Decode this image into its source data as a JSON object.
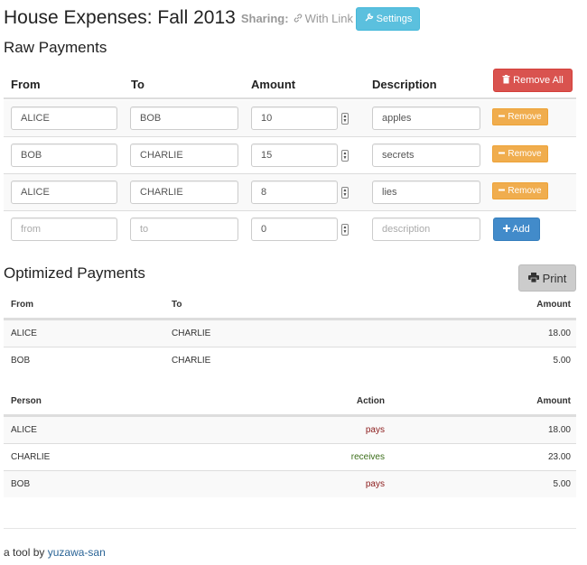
{
  "header": {
    "title": "House Expenses: Fall 2013",
    "sharing_label": "Sharing:",
    "sharing_value": "With Link",
    "settings_label": "Settings"
  },
  "raw_payments": {
    "title": "Raw Payments",
    "columns": [
      "From",
      "To",
      "Amount",
      "Description"
    ],
    "remove_all_label": "Remove All",
    "remove_label": "Remove",
    "add_label": "Add",
    "rows": [
      {
        "from": "ALICE",
        "to": "BOB",
        "amount": "10",
        "description": "apples"
      },
      {
        "from": "BOB",
        "to": "CHARLIE",
        "amount": "15",
        "description": "secrets"
      },
      {
        "from": "ALICE",
        "to": "CHARLIE",
        "amount": "8",
        "description": "lies"
      }
    ],
    "new_row": {
      "from_placeholder": "from",
      "to_placeholder": "to",
      "amount_value": "0",
      "description_placeholder": "description"
    }
  },
  "optimized": {
    "title": "Optimized Payments",
    "print_label": "Print",
    "columns": [
      "From",
      "To",
      "Amount"
    ],
    "rows": [
      {
        "from": "ALICE",
        "to": "CHARLIE",
        "amount": "18.00"
      },
      {
        "from": "BOB",
        "to": "CHARLIE",
        "amount": "5.00"
      }
    ]
  },
  "summary": {
    "columns": [
      "Person",
      "Action",
      "Amount"
    ],
    "rows": [
      {
        "person": "ALICE",
        "action": "pays",
        "amount": "18.00"
      },
      {
        "person": "CHARLIE",
        "action": "receives",
        "amount": "23.00"
      },
      {
        "person": "BOB",
        "action": "pays",
        "amount": "5.00"
      }
    ]
  },
  "footer": {
    "prefix": "a tool by",
    "author": "yuzawa-san"
  },
  "colors": {
    "info": "#5bc0de",
    "danger": "#d9534f",
    "warning": "#f0ad4e",
    "primary": "#428bca",
    "pays": "#8b1a1a",
    "receives": "#3c6e1a"
  }
}
